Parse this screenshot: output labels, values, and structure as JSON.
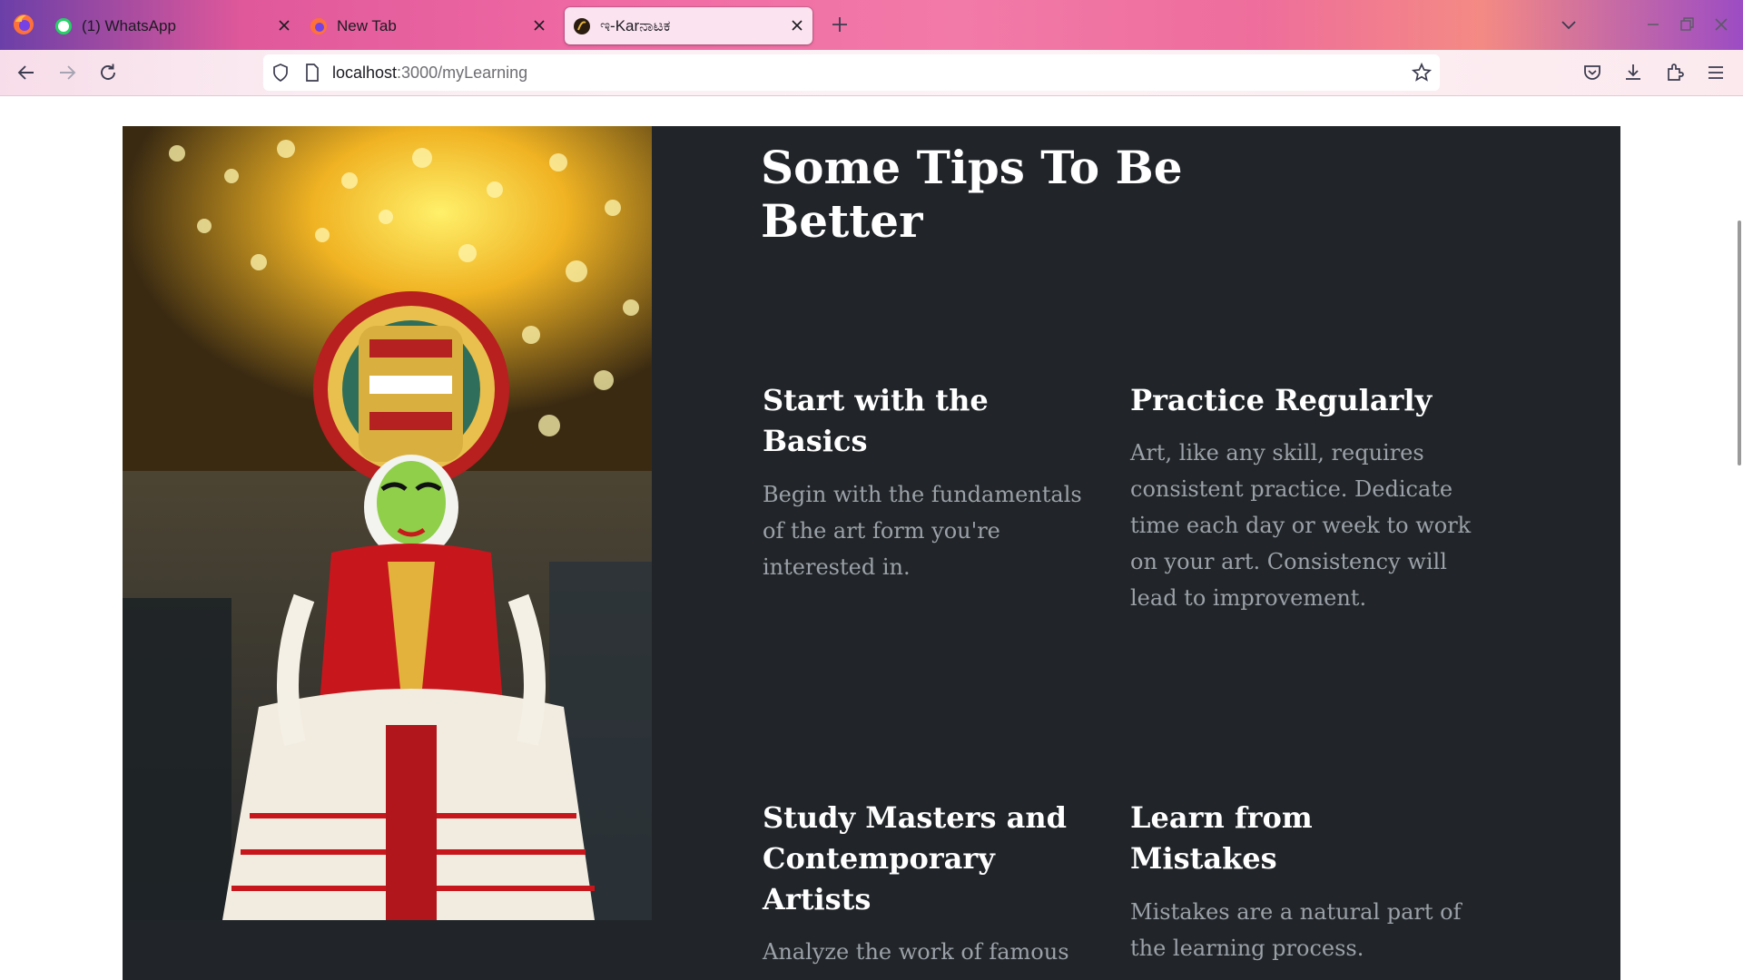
{
  "browser": {
    "tabs": [
      {
        "label": "(1) WhatsApp",
        "favicon": "whatsapp-icon",
        "active": false
      },
      {
        "label": "New Tab",
        "favicon": "firefox-icon",
        "active": false
      },
      {
        "label": "ಇ-Karನಾಟಕ",
        "favicon": "site-logo-icon",
        "active": true
      }
    ],
    "url_host": "localhost",
    "url_path": ":3000/myLearning",
    "whatsapp_badge": "1"
  },
  "page": {
    "title": "Some Tips To Be Better",
    "tips": [
      {
        "title": "Start with the Basics",
        "body": "Begin with the fundamentals of the art form you're interested in."
      },
      {
        "title": "Practice Regularly",
        "body": "Art, like any skill, requires consistent practice. Dedicate time each day or week to work on your art. Consistency will lead to improvement."
      },
      {
        "title": "Study Masters and Contemporary Artists",
        "body": "Analyze the work of famous"
      },
      {
        "title": "Learn from Mistakes",
        "body": "Mistakes are a natural part of the learning process."
      }
    ]
  },
  "colors": {
    "card_bg": "#212529",
    "heading": "#ffffff",
    "body_text": "#9ba1a8"
  }
}
